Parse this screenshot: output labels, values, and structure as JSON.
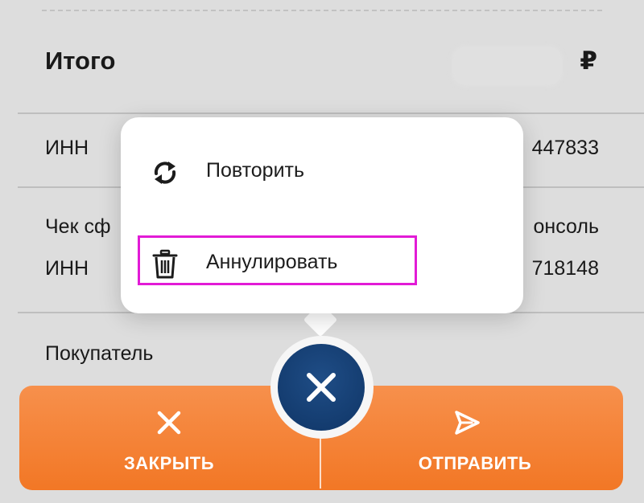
{
  "receipt": {
    "total_label": "Итого",
    "currency_symbol": "₽",
    "inn_label_1": "ИНН",
    "inn_value_1": "447833",
    "check_label_partial": "Чек сф",
    "check_source_partial": "онсоль",
    "inn_label_2": "ИНН",
    "inn_value_2": "718148",
    "buyer_label": "Покупатель"
  },
  "popup_menu": {
    "items": [
      {
        "label": "Повторить",
        "icon": "repeat-icon"
      },
      {
        "label": "Аннулировать",
        "icon": "trash-icon"
      }
    ],
    "highlight_color": "#e21bd6"
  },
  "action_bar": {
    "close_label": "ЗАКРЫТЬ",
    "close_icon": "close-icon",
    "send_label": "ОТПРАВИТЬ",
    "send_icon": "send-icon",
    "accent_color": "#f27725"
  },
  "fab": {
    "icon": "close-icon",
    "color": "#0f3566"
  }
}
